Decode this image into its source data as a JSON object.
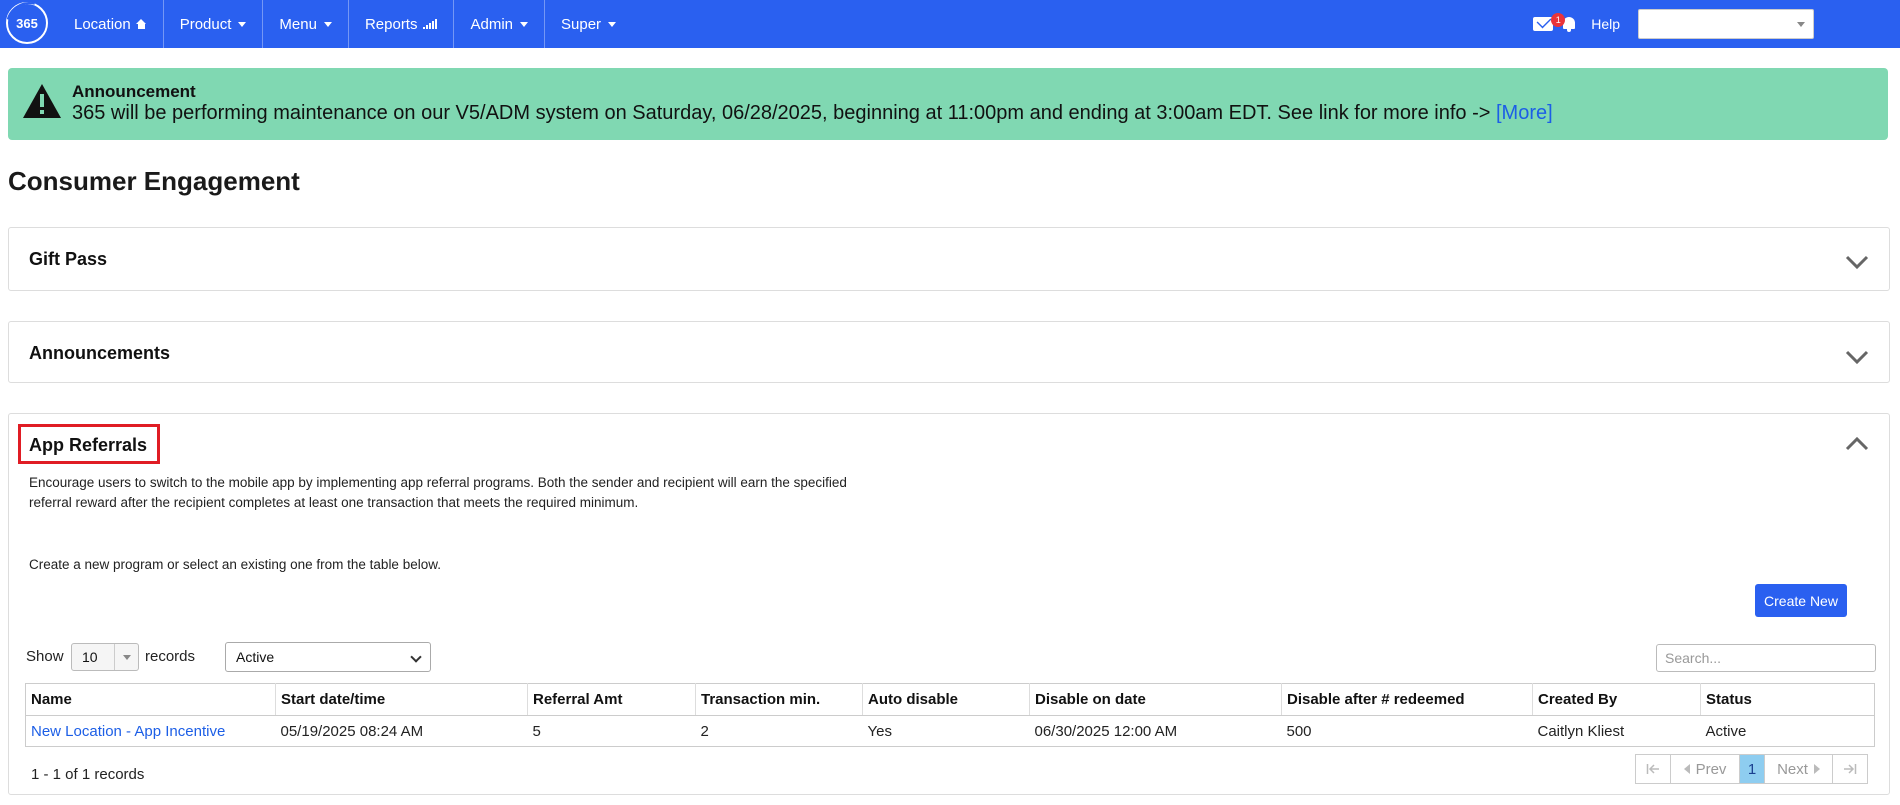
{
  "navbar": {
    "logo_text": "365",
    "items": [
      {
        "label": "Location",
        "icon": "home-icon"
      },
      {
        "label": "Product",
        "icon": "caret-down-icon"
      },
      {
        "label": "Menu",
        "icon": "caret-down-icon"
      },
      {
        "label": "Reports",
        "icon": "signal-bars-icon"
      },
      {
        "label": "Admin",
        "icon": "caret-down-icon"
      },
      {
        "label": "Super",
        "icon": "caret-down-icon"
      }
    ],
    "notification_count": "1",
    "help_label": "Help",
    "location_select_value": ""
  },
  "announcement": {
    "title": "Announcement",
    "body": "365 will be performing maintenance on our V5/ADM system on Saturday, 06/28/2025, beginning at 11:00pm and ending at 3:00am EDT. See link for more info ->",
    "link_label": "[More]",
    "background_color": "#80d8b2"
  },
  "page_title": "Consumer Engagement",
  "panels": {
    "gift_pass": {
      "title": "Gift Pass",
      "state": "collapsed"
    },
    "announcements": {
      "title": "Announcements",
      "state": "collapsed"
    },
    "app_referrals": {
      "title": "App Referrals",
      "state": "expanded",
      "description": "Encourage users to switch to the mobile app by implementing app referral programs. Both the sender and recipient will earn the specified referral reward after the recipient completes at least one transaction that meets the required minimum.",
      "instruction": "Create a new program or select an existing one from the table below.",
      "create_button_label": "Create New",
      "show_label": "Show",
      "page_size": "10",
      "records_label": "records",
      "status_filter": "Active",
      "search_placeholder": "Search...",
      "table": {
        "headers": [
          "Name",
          "Start date/time",
          "Referral Amt",
          "Transaction min.",
          "Auto disable",
          "Disable on date",
          "Disable after # redeemed",
          "Created By",
          "Status"
        ],
        "rows": [
          {
            "name": "New Location - App Incentive",
            "start": "05/19/2025 08:24 AM",
            "referral_amt": "5",
            "transaction_min": "2",
            "auto_disable": "Yes",
            "disable_on_date": "06/30/2025 12:00 AM",
            "disable_after": "500",
            "created_by": "Caitlyn Kliest",
            "status": "Active"
          }
        ]
      },
      "records_info": "1 - 1 of 1 records",
      "pager": {
        "prev_label": "Prev",
        "current_page": "1",
        "next_label": "Next"
      }
    }
  },
  "colors": {
    "navbar": "#2a60f0",
    "link": "#1c5ee6",
    "highlight": "#e01c24"
  }
}
